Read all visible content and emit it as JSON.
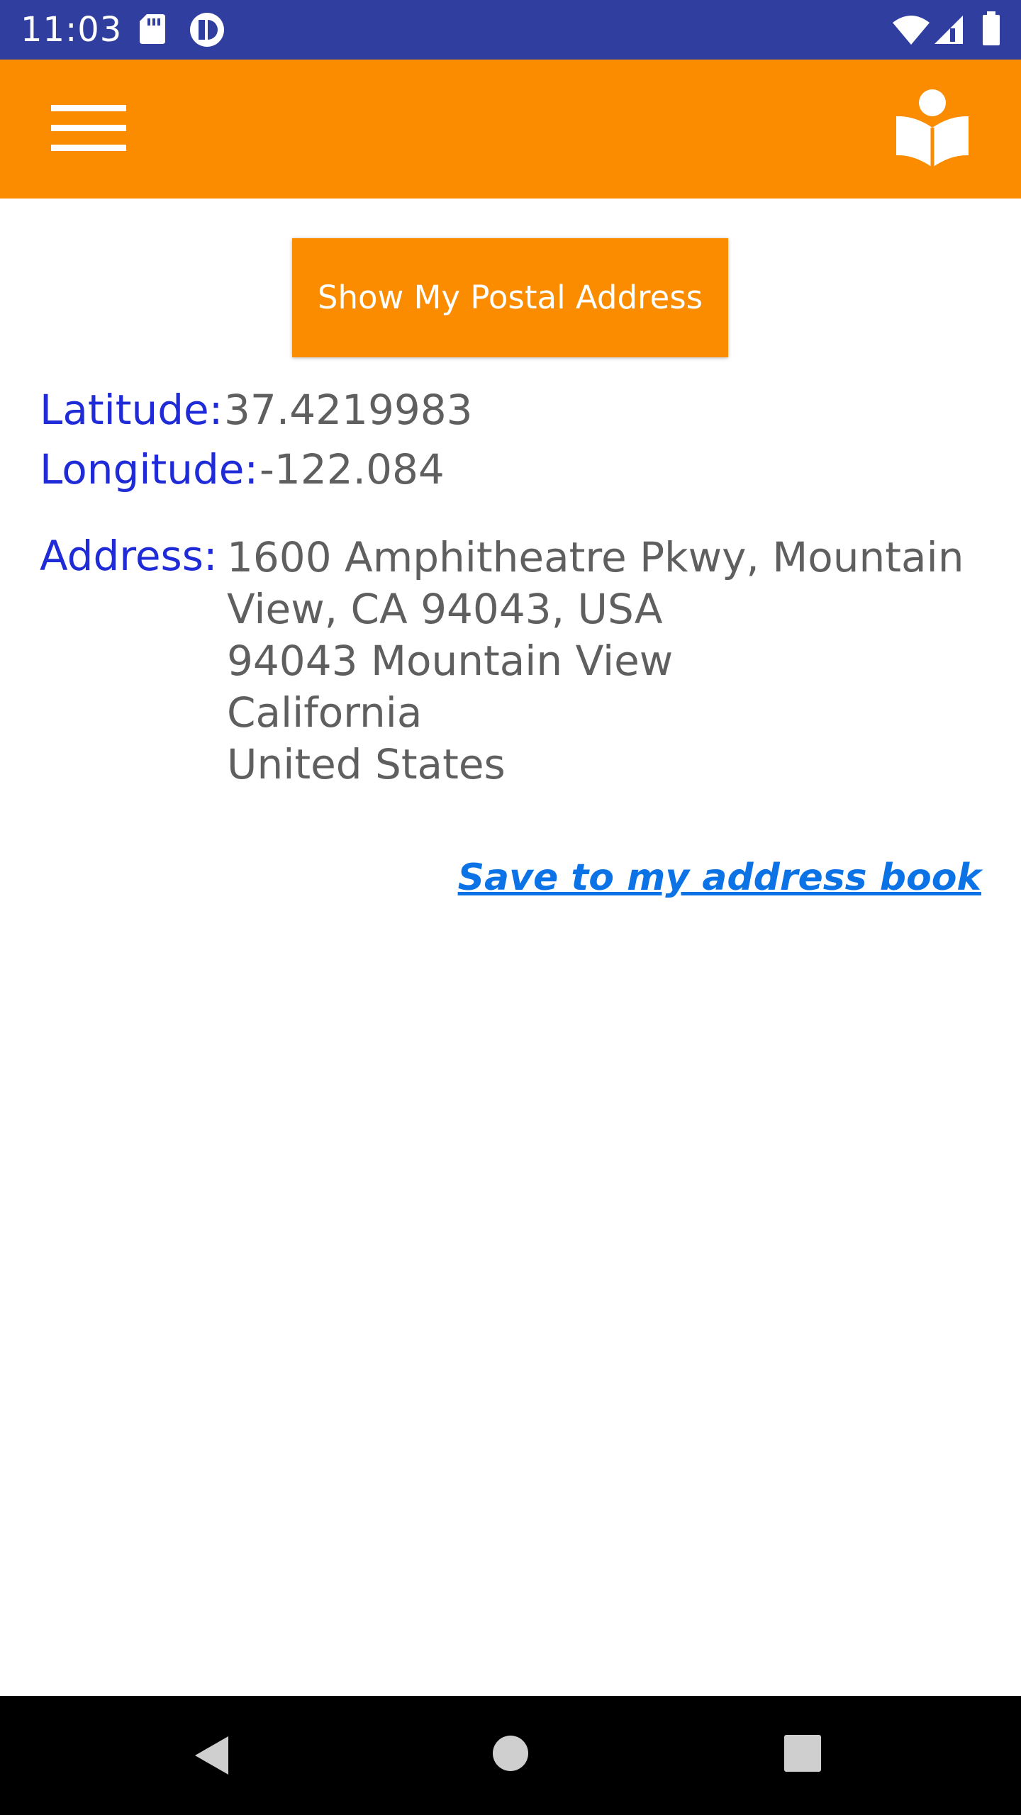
{
  "status_bar": {
    "time": "11:03",
    "left_icons": [
      "sd-card-icon",
      "notification-app-icon"
    ],
    "right_icons": [
      "wifi-icon",
      "cellular-signal-icon",
      "battery-icon"
    ]
  },
  "app_bar": {
    "left_icon": "hamburger-menu-icon",
    "right_icon": "reader-book-icon"
  },
  "main": {
    "button_label": "Show My Postal Address",
    "latitude_label": "Latitude:",
    "latitude_value": "37.4219983",
    "longitude_label": "Longitude:",
    "longitude_value": "-122.084",
    "address_label": "Address:",
    "address_lines": [
      "1600 Amphitheatre Pkwy, Mountain",
      "View, CA 94043, USA",
      "94043 Mountain View",
      "California",
      "United States"
    ],
    "save_link": "Save to my address book"
  },
  "navigation_bar": {
    "buttons": [
      "back-icon",
      "home-icon",
      "recents-icon"
    ]
  },
  "colors": {
    "status_bar": "#303f9f",
    "app_bar": "#fb8c00",
    "label_blue": "#1e2bd6",
    "value_gray": "#5f5f5f",
    "link_blue": "#0b73e6"
  }
}
